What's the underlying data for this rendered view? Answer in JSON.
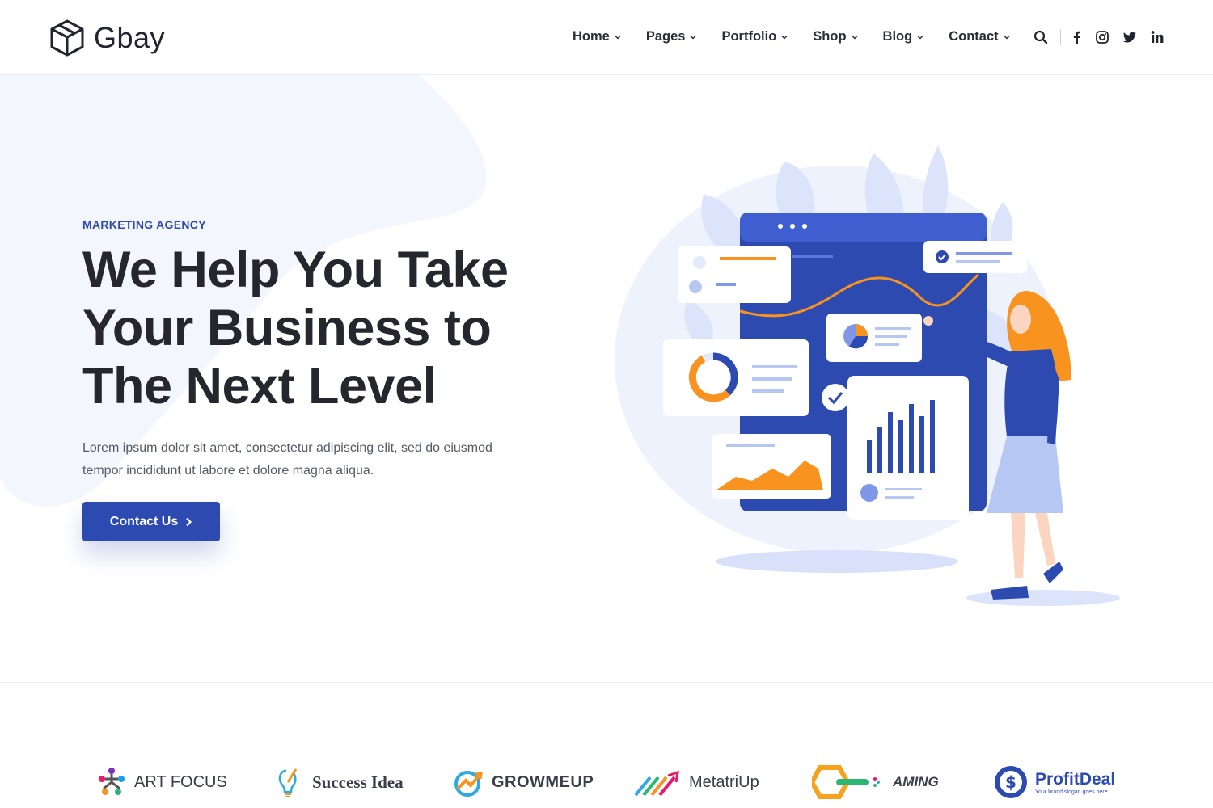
{
  "brand": {
    "name": "Gbay",
    "icon": "box-logo-icon"
  },
  "nav": {
    "items": [
      {
        "label": "Home"
      },
      {
        "label": "Pages"
      },
      {
        "label": "Portfolio"
      },
      {
        "label": "Shop"
      },
      {
        "label": "Blog"
      },
      {
        "label": "Contact"
      }
    ],
    "icons": [
      "search-icon",
      "facebook-icon",
      "instagram-icon",
      "twitter-icon",
      "linkedin-icon"
    ]
  },
  "hero": {
    "eyebrow": "MARKETING AGENCY",
    "title_lines": [
      "We Help You Take",
      "Your Business to",
      "The Next Level"
    ],
    "description_lines": [
      "Lorem ipsum dolor sit amet, consectetur adipiscing elit, sed do eiusmod",
      "tempor incididunt ut labore et dolore magna aliqua."
    ],
    "cta_label": "Contact Us"
  },
  "partners": [
    {
      "name": "ART FOCUS"
    },
    {
      "name": "Success Idea"
    },
    {
      "name": "GROWMEUP"
    },
    {
      "name": "MetatriUp"
    },
    {
      "name": "AMING"
    },
    {
      "name": "ProfitDeal",
      "tagline": "Your brand slogan goes here"
    }
  ],
  "colors": {
    "accent": "#2d4ab0",
    "orange": "#f7931e",
    "dark_text": "#26262f",
    "light_blob": "#f4f6fd"
  }
}
